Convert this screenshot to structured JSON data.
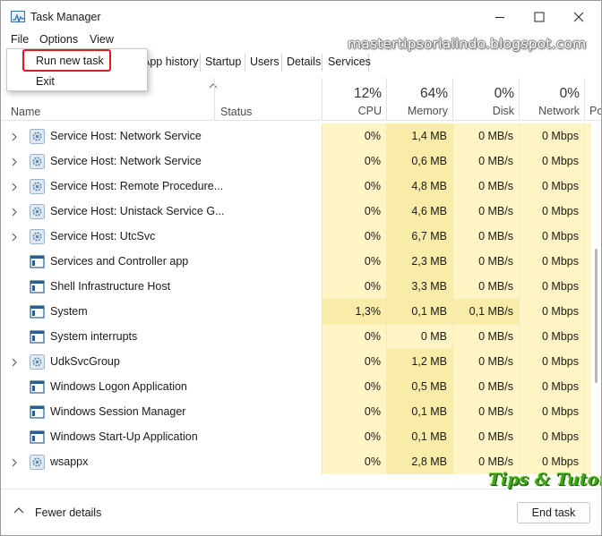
{
  "window": {
    "title": "Task Manager"
  },
  "menu": {
    "file": "File",
    "options": "Options",
    "view": "View"
  },
  "file_menu": {
    "run_new_task": "Run new task",
    "exit": "Exit"
  },
  "tabs": {
    "app_history": "App history",
    "startup": "Startup",
    "users": "Users",
    "details": "Details",
    "services": "Services"
  },
  "watermark": "mastertipsorialindo.blogspot.com",
  "columns": {
    "name": "Name",
    "status": "Status",
    "cpu": {
      "percent": "12%",
      "label": "CPU"
    },
    "memory": {
      "percent": "64%",
      "label": "Memory"
    },
    "disk": {
      "percent": "0%",
      "label": "Disk"
    },
    "network": {
      "percent": "0%",
      "label": "Network"
    },
    "power": {
      "label": "Po"
    }
  },
  "processes": [
    {
      "name": "Service Host: Network Service",
      "icon": "gear-icon",
      "expandable": true,
      "cpu": "0%",
      "memory": "1,4 MB",
      "disk": "0 MB/s",
      "network": "0 Mbps"
    },
    {
      "name": "Service Host: Network Service",
      "icon": "gear-icon",
      "expandable": true,
      "cpu": "0%",
      "memory": "0,6 MB",
      "disk": "0 MB/s",
      "network": "0 Mbps"
    },
    {
      "name": "Service Host: Remote Procedure...",
      "icon": "gear-icon",
      "expandable": true,
      "cpu": "0%",
      "memory": "4,8 MB",
      "disk": "0 MB/s",
      "network": "0 Mbps"
    },
    {
      "name": "Service Host: Unistack Service G...",
      "icon": "gear-icon",
      "expandable": true,
      "cpu": "0%",
      "memory": "4,6 MB",
      "disk": "0 MB/s",
      "network": "0 Mbps"
    },
    {
      "name": "Service Host: UtcSvc",
      "icon": "gear-icon",
      "expandable": true,
      "cpu": "0%",
      "memory": "6,7 MB",
      "disk": "0 MB/s",
      "network": "0 Mbps"
    },
    {
      "name": "Services and Controller app",
      "icon": "window-icon",
      "expandable": false,
      "cpu": "0%",
      "memory": "2,3 MB",
      "disk": "0 MB/s",
      "network": "0 Mbps"
    },
    {
      "name": "Shell Infrastructure Host",
      "icon": "window-icon",
      "expandable": false,
      "cpu": "0%",
      "memory": "3,3 MB",
      "disk": "0 MB/s",
      "network": "0 Mbps"
    },
    {
      "name": "System",
      "icon": "window-icon",
      "expandable": false,
      "cpu": "1,3%",
      "memory": "0,1 MB",
      "disk": "0,1 MB/s",
      "network": "0 Mbps"
    },
    {
      "name": "System interrupts",
      "icon": "window-icon",
      "expandable": false,
      "cpu": "0%",
      "memory": "0 MB",
      "disk": "0 MB/s",
      "network": "0 Mbps"
    },
    {
      "name": "UdkSvcGroup",
      "icon": "gear-icon",
      "expandable": true,
      "cpu": "0%",
      "memory": "1,2 MB",
      "disk": "0 MB/s",
      "network": "0 Mbps"
    },
    {
      "name": "Windows Logon Application",
      "icon": "window-icon",
      "expandable": false,
      "cpu": "0%",
      "memory": "0,5 MB",
      "disk": "0 MB/s",
      "network": "0 Mbps"
    },
    {
      "name": "Windows Session Manager",
      "icon": "window-icon",
      "expandable": false,
      "cpu": "0%",
      "memory": "0,1 MB",
      "disk": "0 MB/s",
      "network": "0 Mbps"
    },
    {
      "name": "Windows Start-Up Application",
      "icon": "window-icon",
      "expandable": false,
      "cpu": "0%",
      "memory": "0,1 MB",
      "disk": "0 MB/s",
      "network": "0 Mbps"
    },
    {
      "name": "wsappx",
      "icon": "gear-icon",
      "expandable": true,
      "cpu": "0%",
      "memory": "2,8 MB",
      "disk": "0 MB/s",
      "network": "0 Mbps"
    }
  ],
  "footer": {
    "fewer_details": "Fewer details",
    "end_task": "End task"
  },
  "logo": "Tips & Tutorial",
  "colors": {
    "cell_light": "#fff4c4",
    "cell_medium": "#f9eca8",
    "highlight_red": "#d81e1e",
    "logo_green": "#3aa51a"
  }
}
